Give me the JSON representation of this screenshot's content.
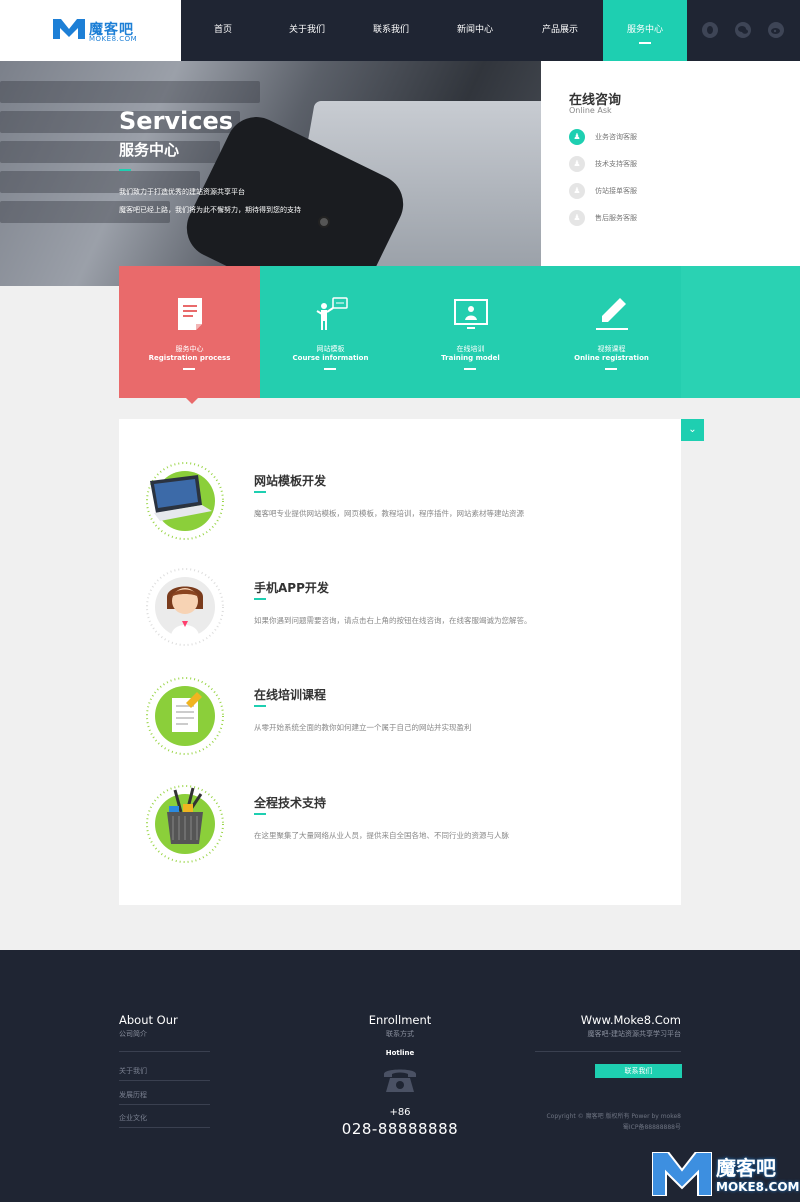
{
  "logo": {
    "brand": "魔客吧",
    "sub": "MOKE8.COM"
  },
  "nav": [
    {
      "label": "首页"
    },
    {
      "label": "关于我们"
    },
    {
      "label": "联系我们"
    },
    {
      "label": "新闻中心"
    },
    {
      "label": "产品展示"
    },
    {
      "label": "服务中心",
      "active": true
    }
  ],
  "social": [
    "qq-icon",
    "wechat-icon",
    "weibo-icon"
  ],
  "banner": {
    "title": "Services",
    "subtitle": "服务中心",
    "desc1": "我们致力于打造优秀的建站资源共享平台",
    "desc2": "魔客吧已经上路，我们将为此不懈努力，期待得到您的支持"
  },
  "online_ask": {
    "title": "在线咨询",
    "subtitle": "Online Ask",
    "items": [
      {
        "label": "业务咨询客服"
      },
      {
        "label": "技术支持客服"
      },
      {
        "label": "仿站接单客服"
      },
      {
        "label": "售后服务客服"
      }
    ]
  },
  "tabs": [
    {
      "zh": "服务中心",
      "en": "Registration process",
      "icon": "document-icon"
    },
    {
      "zh": "网站模板",
      "en": "Course information",
      "icon": "presenter-icon"
    },
    {
      "zh": "在线培训",
      "en": "Training model",
      "icon": "monitor-icon"
    },
    {
      "zh": "视频课程",
      "en": "Online registration",
      "icon": "pen-icon"
    }
  ],
  "services": [
    {
      "title": "网站模板开发",
      "desc": "魔客吧专业提供网站模板，网页模板，教程培训，程序插件，网站素材等建站资源",
      "icon": "laptop-icon"
    },
    {
      "title": "手机APP开发",
      "desc": "如果你遇到问题需要咨询，请点击右上角的按钮在线咨询，在线客服竭诚为您解答。",
      "icon": "support-agent-icon"
    },
    {
      "title": "在线培训课程",
      "desc": "从零开始系统全面的教你如何建立一个属于自己的网站并实现盈利",
      "icon": "notepad-icon"
    },
    {
      "title": "全程技术支持",
      "desc": "在这里聚集了大量网络从业人员，提供来自全国各地、不同行业的资源与人脉",
      "icon": "pencil-cup-icon"
    }
  ],
  "footer": {
    "about": {
      "title": "About Our",
      "sub": "公司简介",
      "links": [
        "关于我们",
        "发展历程",
        "企业文化"
      ]
    },
    "enroll": {
      "title": "Enrollment",
      "sub": "联系方式",
      "hotline": "Hotline",
      "plus": "+86",
      "number": "028-88888888"
    },
    "site": {
      "title": "Www.Moke8.Com",
      "sub": "魔客吧-建站资源共享学习平台",
      "button": "联系我们",
      "copy1": "Copyright © 魔客吧 版权所有 Power by moke8",
      "copy2": "蜀ICP备88888888号"
    }
  },
  "watermark": {
    "zh": "魔客吧",
    "en": "MOKE8.COM"
  },
  "colors": {
    "accent": "#1ecfb1",
    "active_tab": "#e96a6b",
    "dark": "#1f2533"
  }
}
